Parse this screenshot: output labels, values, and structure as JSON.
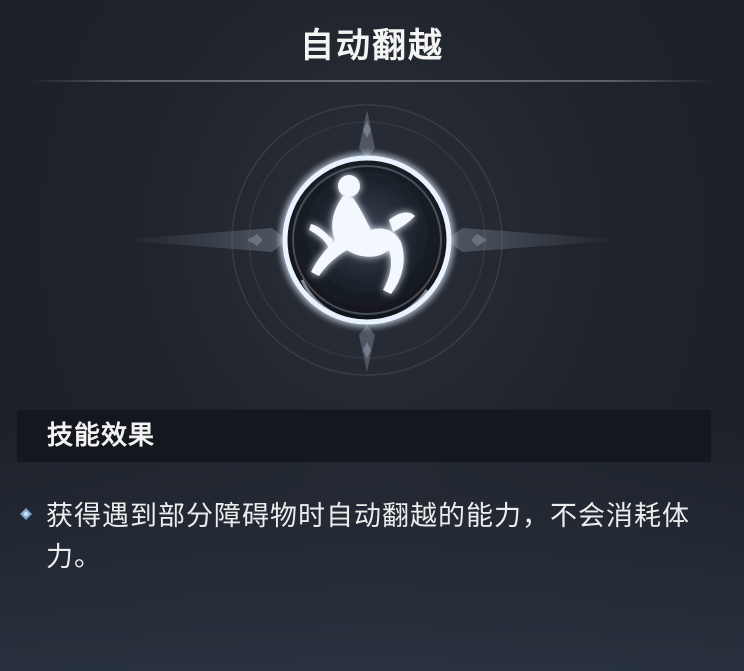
{
  "skill": {
    "title": "自动翻越",
    "icon": "climbing-figure-icon",
    "section_header": "技能效果",
    "description": "获得遇到部分障碍物时自动翻越的能力，不会消耗体力。"
  },
  "colors": {
    "background": "#1f232b",
    "header_bar": "#14171d",
    "text": "#ececec",
    "bullet": "#7fa6c9"
  }
}
